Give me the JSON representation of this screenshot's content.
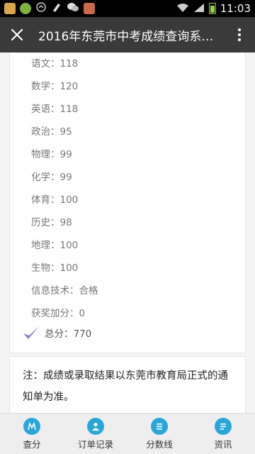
{
  "statusbar": {
    "time": "11:03"
  },
  "titlebar": {
    "title": "2016年东莞市中考成绩查询系…"
  },
  "scores": [
    {
      "text": "语文：118"
    },
    {
      "text": "数学：120"
    },
    {
      "text": "英语：118"
    },
    {
      "text": "政治：95"
    },
    {
      "text": "物理：99"
    },
    {
      "text": "化学：99"
    },
    {
      "text": "体育：100"
    },
    {
      "text": "历史：98"
    },
    {
      "text": "地理：100"
    },
    {
      "text": "生物：100"
    },
    {
      "text": "信息技术：合格"
    },
    {
      "text": "获奖加分：0"
    }
  ],
  "total": {
    "text": "总分：770"
  },
  "note": {
    "text": "注：成绩或录取结果以东莞市教育局正式的通知单为准。"
  },
  "bottom_nav": [
    {
      "label": "查分",
      "icon": "score-icon"
    },
    {
      "label": "订单记录",
      "icon": "order-record-icon"
    },
    {
      "label": "分数线",
      "icon": "score-line-icon"
    },
    {
      "label": "资讯",
      "icon": "news-icon"
    }
  ],
  "colors": {
    "accent": "#2aa6d8",
    "titlebar": "#3a3a3a",
    "checkmark": "#8e7fc2"
  }
}
